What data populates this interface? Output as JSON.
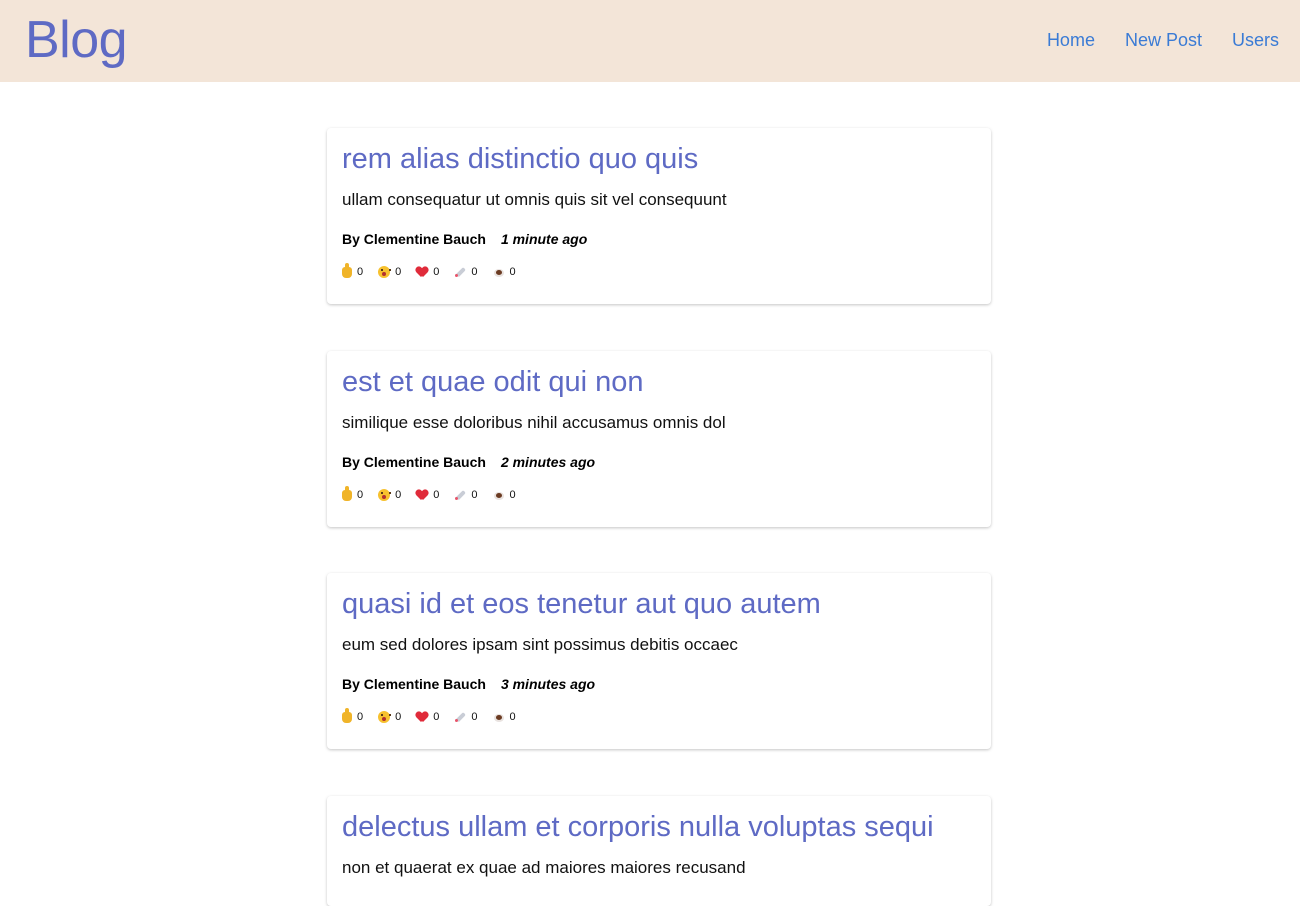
{
  "header": {
    "logo": "Blog",
    "nav": [
      "Home",
      "New Post",
      "Users"
    ]
  },
  "posts": [
    {
      "title": "rem alias distinctio quo quis",
      "excerpt": "ullam consequatur ut omnis quis sit vel consequunt",
      "author": "By Clementine Bauch",
      "time": "1 minute ago",
      "reactions": [
        {
          "icon": "thumbs-up-icon",
          "count": "0"
        },
        {
          "icon": "wow-face-icon",
          "count": "0"
        },
        {
          "icon": "heart-icon",
          "count": "0"
        },
        {
          "icon": "rocket-icon",
          "count": "0"
        },
        {
          "icon": "coffee-icon",
          "count": "0"
        }
      ]
    },
    {
      "title": "est et quae odit qui non",
      "excerpt": "similique esse doloribus nihil accusamus omnis dol",
      "author": "By Clementine Bauch",
      "time": "2 minutes ago",
      "reactions": [
        {
          "icon": "thumbs-up-icon",
          "count": "0"
        },
        {
          "icon": "wow-face-icon",
          "count": "0"
        },
        {
          "icon": "heart-icon",
          "count": "0"
        },
        {
          "icon": "rocket-icon",
          "count": "0"
        },
        {
          "icon": "coffee-icon",
          "count": "0"
        }
      ]
    },
    {
      "title": "quasi id et eos tenetur aut quo autem",
      "excerpt": "eum sed dolores ipsam sint possimus debitis occaec",
      "author": "By Clementine Bauch",
      "time": "3 minutes ago",
      "reactions": [
        {
          "icon": "thumbs-up-icon",
          "count": "0"
        },
        {
          "icon": "wow-face-icon",
          "count": "0"
        },
        {
          "icon": "heart-icon",
          "count": "0"
        },
        {
          "icon": "rocket-icon",
          "count": "0"
        },
        {
          "icon": "coffee-icon",
          "count": "0"
        }
      ]
    },
    {
      "title": "delectus ullam et corporis nulla voluptas sequi",
      "excerpt": "non et quaerat ex quae ad maiores maiores recusand"
    }
  ],
  "colors": {
    "header_bg": "#f3e5d8",
    "brand": "#5e6ac4",
    "link": "#3a7bd5"
  }
}
